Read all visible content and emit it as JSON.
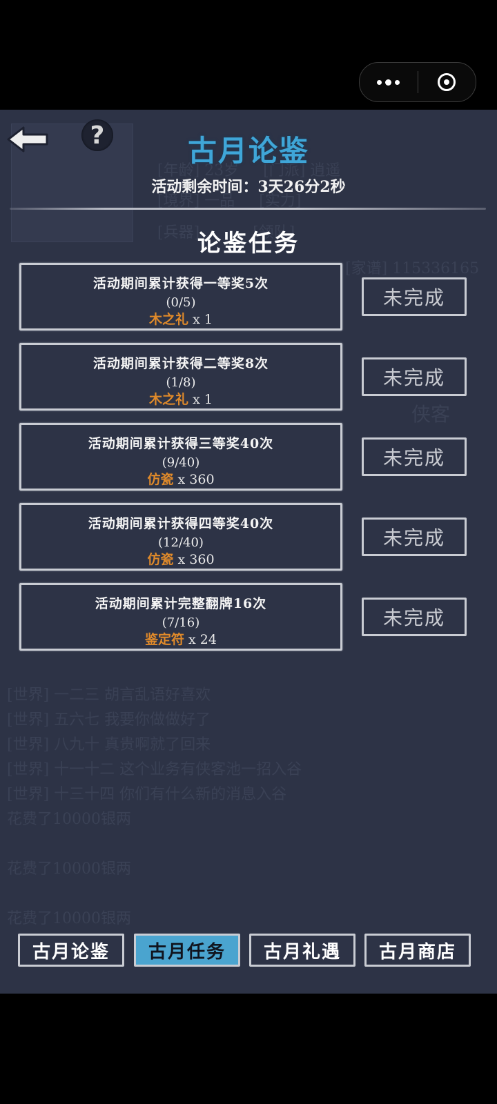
{
  "capsule": {
    "menu_icon": "more-dots-icon",
    "close_icon": "target-ring-icon"
  },
  "header": {
    "back_icon": "back-arrow-icon",
    "help_label": "?",
    "title": "古月论鉴",
    "countdown": "活动剩余时间：3天26分2秒"
  },
  "section_title": "论鉴任务",
  "tasks": [
    {
      "desc": "活动期间累计获得一等奖5次",
      "progress": "(0/5)",
      "reward_name": "木之礼",
      "reward_qty": " x 1",
      "status": "未完成"
    },
    {
      "desc": "活动期间累计获得二等奖8次",
      "progress": "(1/8)",
      "reward_name": "木之礼",
      "reward_qty": " x 1",
      "status": "未完成"
    },
    {
      "desc": "活动期间累计获得三等奖40次",
      "progress": "(9/40)",
      "reward_name": "仿瓷",
      "reward_qty": " x 360",
      "status": "未完成"
    },
    {
      "desc": "活动期间累计获得四等奖40次",
      "progress": "(12/40)",
      "reward_name": "仿瓷",
      "reward_qty": " x 360",
      "status": "未完成"
    },
    {
      "desc": "活动期间累计完整翻牌16次",
      "progress": "(7/16)",
      "reward_name": "鉴定符",
      "reward_qty": " x 24",
      "status": "未完成"
    }
  ],
  "tabs": [
    {
      "label": "古月论鉴",
      "active": false
    },
    {
      "label": "古月任务",
      "active": true
    },
    {
      "label": "古月礼遇",
      "active": false
    },
    {
      "label": "古月商店",
      "active": false
    }
  ],
  "colors": {
    "panel_bg": "#2d3346",
    "title_blue": "#3fa6d8",
    "reward_orange": "#e08a2a",
    "active_tab": "#4aa4cf",
    "border": "#c9ccd3"
  }
}
